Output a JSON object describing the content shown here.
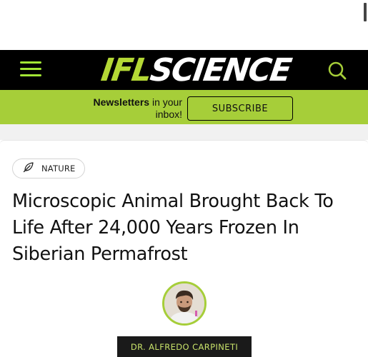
{
  "header": {
    "logo_left": "IFL",
    "logo_right": "SCIENCE",
    "menu_icon": "hamburger-menu-icon",
    "search_icon": "search-icon"
  },
  "newsletter": {
    "text_bold": "Newsletters",
    "text_rest_line1": " in your",
    "text_rest_line2": "inbox!",
    "button_label": "SUBSCRIBE"
  },
  "article": {
    "category": "NATURE",
    "category_icon": "leaf-icon",
    "title": "Microscopic Animal Brought Back To Life After 24,000 Years Frozen In Siberian Permafrost",
    "author": "DR. ALFREDO CARPINETI"
  },
  "colors": {
    "brand_green": "#a6ce39",
    "header_bg": "#000000",
    "author_bg": "#1a1a1a"
  }
}
